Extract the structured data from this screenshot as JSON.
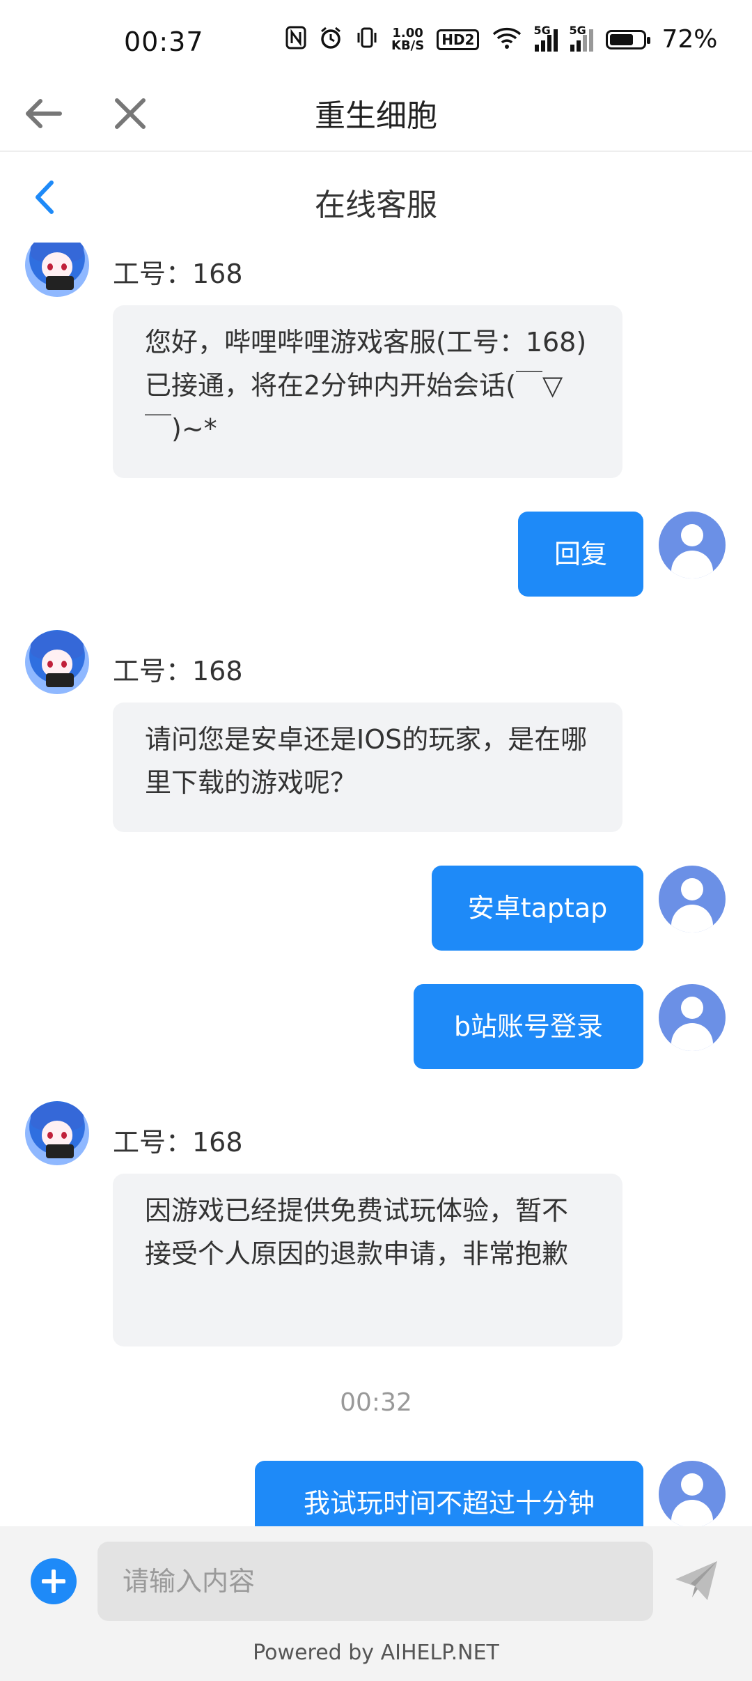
{
  "status_bar": {
    "time": "00:37",
    "net_speed_value": "1.00",
    "net_speed_unit": "KB/S",
    "hd_badge": "HD2",
    "signal1_label": "5G",
    "signal2_label": "5G",
    "battery_level": 0.72,
    "battery_text": "72%",
    "icons": [
      "nfc-icon",
      "alarm-icon",
      "vibrate-icon",
      "wifi-icon",
      "signal-icon",
      "battery-icon"
    ]
  },
  "title_bar": {
    "title": "重生细胞"
  },
  "header": {
    "title": "在线客服"
  },
  "messages": [
    {
      "from": "agent",
      "label": "工号：168",
      "text": "您好，哔哩哔哩游戏客服(工号：168)已接通，将在2分钟内开始会话(￣▽￣)~*"
    },
    {
      "from": "user",
      "text": "回复"
    },
    {
      "from": "agent",
      "label": "工号：168",
      "text": "请问您是安卓还是IOS的玩家，是在哪里下载的游戏呢？"
    },
    {
      "from": "user",
      "text": "安卓taptap"
    },
    {
      "from": "user",
      "text": "b站账号登录"
    },
    {
      "from": "agent",
      "label": "工号：168",
      "text": "因游戏已经提供免费试玩体验，暂不接受个人原因的退款申请，非常抱歉"
    },
    {
      "from": "system",
      "text": "00:32"
    },
    {
      "from": "user",
      "text": "我试玩时间不超过十分钟"
    }
  ],
  "input": {
    "placeholder": "请输入内容",
    "value": ""
  },
  "footer": {
    "powered_by": "Powered by AIHELP.NET"
  },
  "colors": {
    "accent": "#1e8af8",
    "agent_bubble": "#f2f3f5",
    "user_avatar": "#6b90e6",
    "input_bar_bg": "#f3f3f3"
  }
}
